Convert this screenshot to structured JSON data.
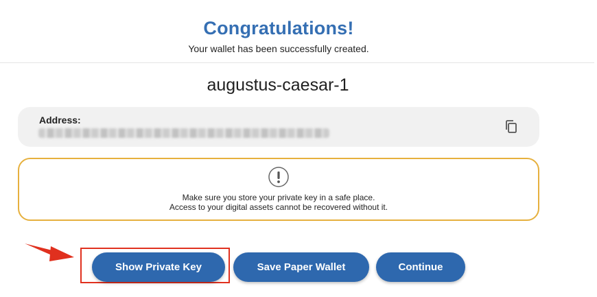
{
  "header": {
    "title": "Congratulations!",
    "subtitle": "Your wallet has been successfully created."
  },
  "wallet": {
    "name": "augustus-caesar-1",
    "address_label": "Address:",
    "address_value": ""
  },
  "warning": {
    "line1": "Make sure you store your private key in a safe place.",
    "line2": "Access to your digital assets cannot be recovered without it."
  },
  "actions": {
    "show_private_key": "Show Private Key",
    "save_paper_wallet": "Save Paper Wallet",
    "continue": "Continue"
  },
  "icons": {
    "copy": "copy-icon",
    "warning": "exclamation-circle-icon",
    "annotation_arrow": "arrow-icon"
  },
  "colors": {
    "title": "#356fb3",
    "button": "#2e68ae",
    "warning_border": "#e6b03d",
    "annotation": "#e0301e",
    "address_bg": "#f1f1f1"
  }
}
